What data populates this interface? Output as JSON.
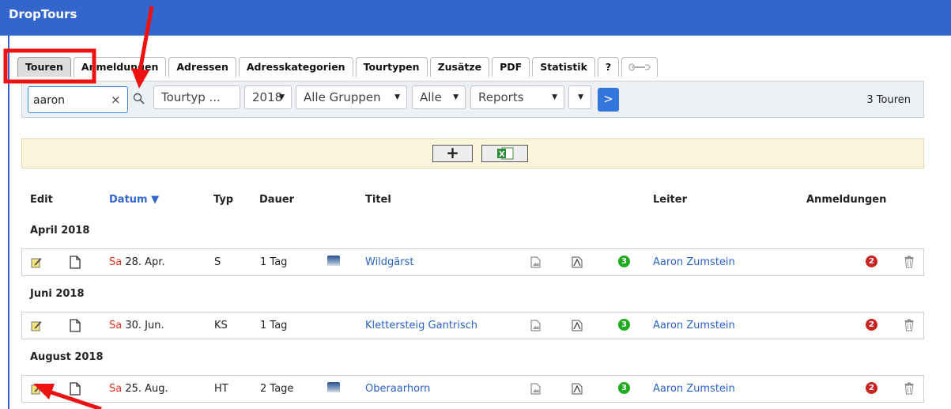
{
  "app": {
    "title": "DropTours"
  },
  "tabs": [
    {
      "label": "Touren",
      "active": true
    },
    {
      "label": "Anmeldungen"
    },
    {
      "label": "Adressen"
    },
    {
      "label": "Adresskategorien"
    },
    {
      "label": "Tourtypen"
    },
    {
      "label": "Zusätze"
    },
    {
      "label": "PDF"
    },
    {
      "label": "Statistik"
    },
    {
      "label": "?"
    },
    {
      "label": "",
      "icon": "wrench-icon"
    }
  ],
  "filters": {
    "search_value": "aaron",
    "clear_icon": "×",
    "tourtyp": "Tourtyp ...",
    "year": "2018",
    "gruppen": "Alle Gruppen",
    "alle": "Alle",
    "reports": "Reports",
    "extra": "",
    "go": ">",
    "count": "3 Touren"
  },
  "actions": {
    "add": "+",
    "excel_icon": "excel-icon"
  },
  "columns": {
    "edit": "Edit",
    "datum": "Datum ▼",
    "typ": "Typ",
    "dauer": "Dauer",
    "titel": "Titel",
    "leiter": "Leiter",
    "anmeldungen": "Anmeldungen"
  },
  "groups": [
    {
      "label": "April 2018",
      "tours": [
        {
          "day": "Sa",
          "date": "28. Apr.",
          "typ": "S",
          "dauer": "1 Tag",
          "has_image": true,
          "titel": "Wildgärst",
          "count": "3",
          "leiter": "Aaron Zumstein",
          "anmeldungen": "2"
        }
      ]
    },
    {
      "label": "Juni 2018",
      "tours": [
        {
          "day": "Sa",
          "date": "30. Jun.",
          "typ": "KS",
          "dauer": "1 Tag",
          "has_image": false,
          "titel": "Klettersteig Gantrisch",
          "count": "3",
          "leiter": "Aaron Zumstein",
          "anmeldungen": "2"
        }
      ]
    },
    {
      "label": "August 2018",
      "tours": [
        {
          "day": "Sa",
          "date": "25. Aug.",
          "typ": "HT",
          "dauer": "2 Tage",
          "has_image": true,
          "titel": "Oberaarhorn",
          "count": "3",
          "leiter": "Aaron Zumstein",
          "anmeldungen": "2"
        }
      ]
    }
  ],
  "colors": {
    "header": "#3366cc",
    "link": "#2a64c2",
    "date_day": "#dd3322",
    "badge_green": "#1faa1f",
    "badge_red": "#cc2222",
    "annotation": "#ee1111"
  }
}
